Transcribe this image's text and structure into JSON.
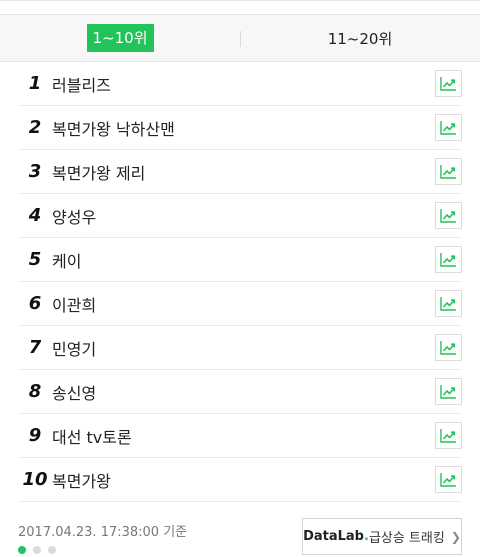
{
  "tabs": [
    {
      "label": "1~10위",
      "active": true
    },
    {
      "label": "11~20위",
      "active": false
    }
  ],
  "ranking": [
    {
      "rank": "1",
      "keyword": "러블리즈"
    },
    {
      "rank": "2",
      "keyword": "복면가왕 낙하산맨"
    },
    {
      "rank": "3",
      "keyword": "복면가왕 제리"
    },
    {
      "rank": "4",
      "keyword": "양성우"
    },
    {
      "rank": "5",
      "keyword": "케이"
    },
    {
      "rank": "6",
      "keyword": "이관희"
    },
    {
      "rank": "7",
      "keyword": "민영기"
    },
    {
      "rank": "8",
      "keyword": "송신영"
    },
    {
      "rank": "9",
      "keyword": "대선 tv토론"
    },
    {
      "rank": "10",
      "keyword": "복면가왕"
    }
  ],
  "trend_icon": "trend-chart-icon",
  "footer": {
    "timestamp": "2017.04.23. 17:38:00 기준",
    "datalab_brand": "DataLab",
    "datalab_dot": ".",
    "datalab_label": "급상승 트래킹",
    "pagination": {
      "current": 1,
      "total": 3
    }
  },
  "colors": {
    "accent": "#21c35a"
  }
}
